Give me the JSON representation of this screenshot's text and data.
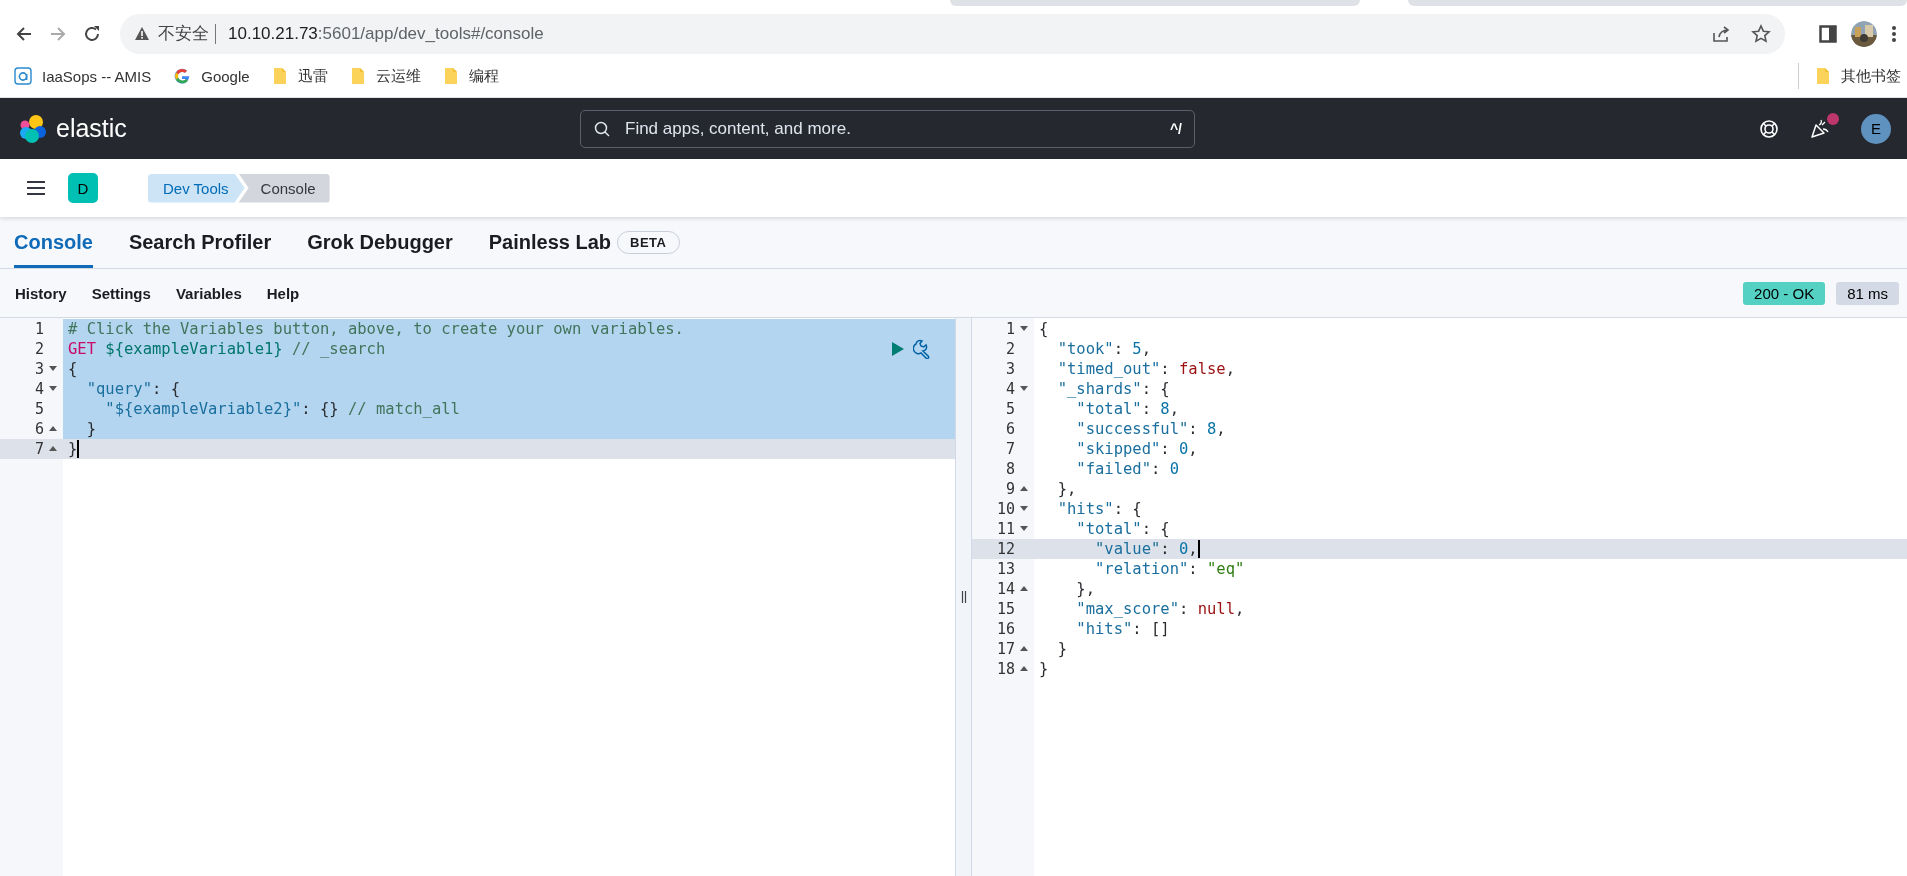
{
  "browser": {
    "security_label": "不安全",
    "url_host": "10.10.21.73",
    "url_path": ":5601/app/dev_tools#/console",
    "bookmarks": [
      {
        "kind": "site",
        "label": "IaaSops -- AMIS"
      },
      {
        "kind": "google",
        "label": "Google"
      },
      {
        "kind": "folder",
        "label": "迅雷"
      },
      {
        "kind": "folder",
        "label": "云运维"
      },
      {
        "kind": "folder",
        "label": "编程"
      }
    ],
    "other_bookmarks": "其他书签"
  },
  "header": {
    "logo_text": "elastic",
    "search": {
      "placeholder": "Find apps, content, and more.",
      "shortcut": "^/"
    },
    "news_unread": true,
    "user_initial": "E"
  },
  "nav": {
    "space_initial": "D",
    "breadcrumbs": [
      {
        "label": "Dev Tools",
        "selected": false
      },
      {
        "label": "Console",
        "selected": true
      }
    ]
  },
  "tabs": [
    {
      "label": "Console",
      "selected": true
    },
    {
      "label": "Search Profiler",
      "selected": false
    },
    {
      "label": "Grok Debugger",
      "selected": false
    },
    {
      "label": "Painless Lab",
      "selected": false,
      "badge": "BETA"
    }
  ],
  "toolbar": {
    "links": [
      "History",
      "Settings",
      "Variables",
      "Help"
    ],
    "status": "200 - OK",
    "duration": "81 ms"
  },
  "editors": [
    {
      "kind": "request",
      "lines": [
        {
          "number": "1",
          "fold_start": false,
          "fold_end": false,
          "selected": true,
          "active": false,
          "tokens": [
            {
              "kind": "comment",
              "text": "# Click the Variables button, above, to create your own variables."
            }
          ]
        },
        {
          "number": "2",
          "fold_start": false,
          "fold_end": false,
          "selected": true,
          "active": false,
          "tokens": [
            {
              "kind": "method",
              "text": "GET "
            },
            {
              "kind": "url",
              "text": "${exampleVariable1} "
            },
            {
              "kind": "comment",
              "text": "// _search"
            }
          ]
        },
        {
          "number": "3",
          "fold_start": true,
          "fold_end": false,
          "selected": true,
          "active": false,
          "tokens": [
            {
              "kind": "punct",
              "text": "{"
            }
          ]
        },
        {
          "number": "4",
          "fold_start": true,
          "fold_end": false,
          "selected": true,
          "active": false,
          "tokens": [
            {
              "kind": "key",
              "text": "  \"query\""
            },
            {
              "kind": "punct",
              "text": ": {"
            }
          ]
        },
        {
          "number": "5",
          "fold_start": false,
          "fold_end": false,
          "selected": true,
          "active": false,
          "tokens": [
            {
              "kind": "key",
              "text": "    \"${exampleVariable2}\""
            },
            {
              "kind": "punct",
              "text": ": {} "
            },
            {
              "kind": "comment",
              "text": "// match_all"
            }
          ]
        },
        {
          "number": "6",
          "fold_start": false,
          "fold_end": true,
          "selected": true,
          "active": false,
          "tokens": [
            {
              "kind": "punct",
              "text": "  }"
            }
          ]
        },
        {
          "number": "7",
          "fold_start": false,
          "fold_end": true,
          "selected": false,
          "active": true,
          "tokens": [
            {
              "kind": "punct",
              "text": "}"
            }
          ]
        }
      ]
    },
    {
      "kind": "response",
      "lines": [
        {
          "number": "1",
          "fold_start": true,
          "fold_end": false,
          "active": false,
          "tokens": [
            {
              "kind": "punct",
              "text": "{"
            }
          ]
        },
        {
          "number": "2",
          "fold_start": false,
          "fold_end": false,
          "active": false,
          "tokens": [
            {
              "kind": "key",
              "text": "  \"took\""
            },
            {
              "kind": "punct",
              "text": ": "
            },
            {
              "kind": "number",
              "text": "5"
            },
            {
              "kind": "punct",
              "text": ","
            }
          ]
        },
        {
          "number": "3",
          "fold_start": false,
          "fold_end": false,
          "active": false,
          "tokens": [
            {
              "kind": "key",
              "text": "  \"timed_out\""
            },
            {
              "kind": "punct",
              "text": ": "
            },
            {
              "kind": "literal",
              "text": "false"
            },
            {
              "kind": "punct",
              "text": ","
            }
          ]
        },
        {
          "number": "4",
          "fold_start": true,
          "fold_end": false,
          "active": false,
          "tokens": [
            {
              "kind": "key",
              "text": "  \"_shards\""
            },
            {
              "kind": "punct",
              "text": ": {"
            }
          ]
        },
        {
          "number": "5",
          "fold_start": false,
          "fold_end": false,
          "active": false,
          "tokens": [
            {
              "kind": "key",
              "text": "    \"total\""
            },
            {
              "kind": "punct",
              "text": ": "
            },
            {
              "kind": "number",
              "text": "8"
            },
            {
              "kind": "punct",
              "text": ","
            }
          ]
        },
        {
          "number": "6",
          "fold_start": false,
          "fold_end": false,
          "active": false,
          "tokens": [
            {
              "kind": "key",
              "text": "    \"successful\""
            },
            {
              "kind": "punct",
              "text": ": "
            },
            {
              "kind": "number",
              "text": "8"
            },
            {
              "kind": "punct",
              "text": ","
            }
          ]
        },
        {
          "number": "7",
          "fold_start": false,
          "fold_end": false,
          "active": false,
          "tokens": [
            {
              "kind": "key",
              "text": "    \"skipped\""
            },
            {
              "kind": "punct",
              "text": ": "
            },
            {
              "kind": "number",
              "text": "0"
            },
            {
              "kind": "punct",
              "text": ","
            }
          ]
        },
        {
          "number": "8",
          "fold_start": false,
          "fold_end": false,
          "active": false,
          "tokens": [
            {
              "kind": "key",
              "text": "    \"failed\""
            },
            {
              "kind": "punct",
              "text": ": "
            },
            {
              "kind": "number",
              "text": "0"
            }
          ]
        },
        {
          "number": "9",
          "fold_start": false,
          "fold_end": true,
          "active": false,
          "tokens": [
            {
              "kind": "punct",
              "text": "  },"
            }
          ]
        },
        {
          "number": "10",
          "fold_start": true,
          "fold_end": false,
          "active": false,
          "tokens": [
            {
              "kind": "key",
              "text": "  \"hits\""
            },
            {
              "kind": "punct",
              "text": ": {"
            }
          ]
        },
        {
          "number": "11",
          "fold_start": true,
          "fold_end": false,
          "active": false,
          "tokens": [
            {
              "kind": "key",
              "text": "    \"total\""
            },
            {
              "kind": "punct",
              "text": ": {"
            }
          ]
        },
        {
          "number": "12",
          "fold_start": false,
          "fold_end": false,
          "active": true,
          "tokens": [
            {
              "kind": "key",
              "text": "      \"value\""
            },
            {
              "kind": "punct",
              "text": ": "
            },
            {
              "kind": "number",
              "text": "0"
            },
            {
              "kind": "punct",
              "text": ","
            }
          ]
        },
        {
          "number": "13",
          "fold_start": false,
          "fold_end": false,
          "active": false,
          "tokens": [
            {
              "kind": "key",
              "text": "      \"relation\""
            },
            {
              "kind": "punct",
              "text": ": "
            },
            {
              "kind": "string",
              "text": "\"eq\""
            }
          ]
        },
        {
          "number": "14",
          "fold_start": false,
          "fold_end": true,
          "active": false,
          "tokens": [
            {
              "kind": "punct",
              "text": "    },"
            }
          ]
        },
        {
          "number": "15",
          "fold_start": false,
          "fold_end": false,
          "active": false,
          "tokens": [
            {
              "kind": "key",
              "text": "    \"max_score\""
            },
            {
              "kind": "punct",
              "text": ": "
            },
            {
              "kind": "literal",
              "text": "null"
            },
            {
              "kind": "punct",
              "text": ","
            }
          ]
        },
        {
          "number": "16",
          "fold_start": false,
          "fold_end": false,
          "active": false,
          "tokens": [
            {
              "kind": "key",
              "text": "    \"hits\""
            },
            {
              "kind": "punct",
              "text": ": []"
            }
          ]
        },
        {
          "number": "17",
          "fold_start": false,
          "fold_end": true,
          "active": false,
          "tokens": [
            {
              "kind": "punct",
              "text": "  }"
            }
          ]
        },
        {
          "number": "18",
          "fold_start": false,
          "fold_end": true,
          "active": false,
          "tokens": [
            {
              "kind": "punct",
              "text": "}"
            }
          ]
        }
      ]
    }
  ]
}
